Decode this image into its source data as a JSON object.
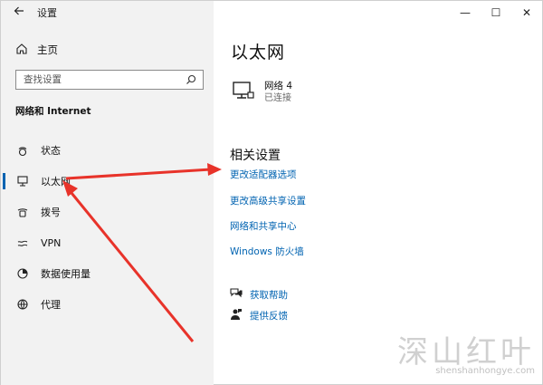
{
  "window": {
    "app_title": "设置",
    "back_icon": "back-arrow-icon",
    "controls": {
      "minimize": "—",
      "maximize": "☐",
      "close": "✕"
    }
  },
  "sidebar": {
    "home_label": "主页",
    "search_placeholder": "查找设置",
    "section_title": "网络和 Internet",
    "items": [
      {
        "label": "状态",
        "icon": "status-icon",
        "active": false
      },
      {
        "label": "以太网",
        "icon": "ethernet-icon",
        "active": true
      },
      {
        "label": "拨号",
        "icon": "dialup-icon",
        "active": false
      },
      {
        "label": "VPN",
        "icon": "vpn-icon",
        "active": false
      },
      {
        "label": "数据使用量",
        "icon": "data-usage-icon",
        "active": false
      },
      {
        "label": "代理",
        "icon": "proxy-icon",
        "active": false
      }
    ]
  },
  "main": {
    "title": "以太网",
    "network": {
      "name": "网络 4",
      "status": "已连接",
      "icon": "ethernet-monitor-icon"
    },
    "related_title": "相关设置",
    "links": [
      "更改适配器选项",
      "更改高级共享设置",
      "网络和共享中心",
      "Windows 防火墙"
    ],
    "help": [
      {
        "label": "获取帮助",
        "icon": "help-chat-icon"
      },
      {
        "label": "提供反馈",
        "icon": "feedback-icon"
      }
    ]
  },
  "watermark": {
    "text_cn": "深山红叶",
    "text_en": "shenshanhongye.com"
  },
  "colors": {
    "accent": "#0063b1",
    "sidebar_bg": "#f2f2f2",
    "arrow": "#e8332a"
  }
}
